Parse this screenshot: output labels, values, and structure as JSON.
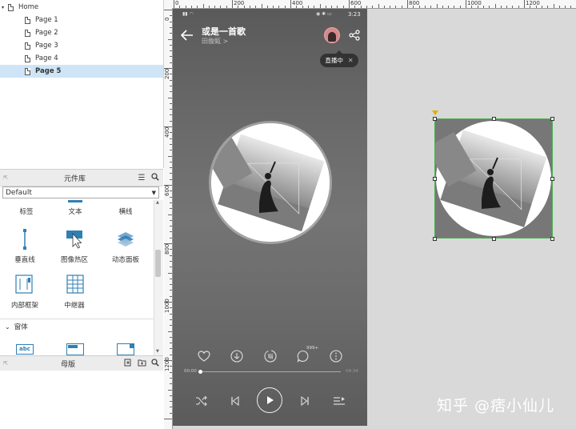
{
  "pages": {
    "home": "Home",
    "items": [
      "Page 1",
      "Page 2",
      "Page 3",
      "Page 4",
      "Page 5"
    ],
    "selected": "Page 5"
  },
  "library": {
    "title": "元件库",
    "selected_library": "Default",
    "widgets_row1": [
      "标签",
      "文本",
      "横线"
    ],
    "widgets_row2": [
      "垂直线",
      "图像热区",
      "动态面板"
    ],
    "widgets_row3": [
      "内部框架",
      "中继器"
    ],
    "section": "窗体",
    "form_icon_label": "abc"
  },
  "masters": {
    "title": "母版"
  },
  "rulers": {
    "h_labels": [
      "0",
      "200",
      "400",
      "600",
      "800",
      "1000",
      "1200"
    ],
    "v_labels": [
      "0",
      "200",
      "400",
      "600",
      "800",
      "1000",
      "1200"
    ]
  },
  "phone": {
    "time": "3:23",
    "song_title": "或是一首歌",
    "artist": "田馥甄 >",
    "live_label": "直播中",
    "comment_count": "999+",
    "current_time": "00:00",
    "total_time": "04:34",
    "progress": 0.0
  },
  "watermark": "知乎 @痞小仙儿",
  "colors": {
    "selection_border": "#4caf50",
    "tree_selected": "#cfe5f7"
  }
}
